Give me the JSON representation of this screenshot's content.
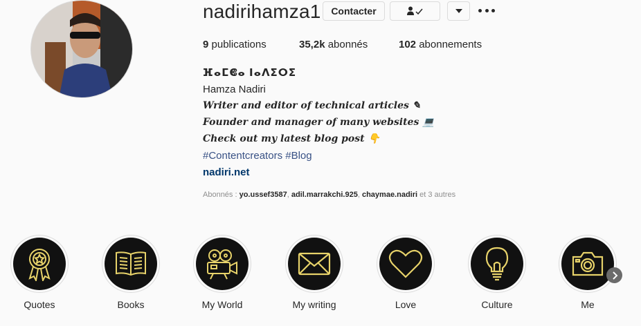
{
  "profile": {
    "username": "nadirihamza1",
    "contact_label": "Contacter",
    "follow_status_icon": "person-check-icon",
    "dropdown_icon": "caret-down-icon",
    "more_icon": "more-options-icon"
  },
  "stats": {
    "posts_count": "9",
    "posts_label": " publications",
    "followers_count": "35,2k",
    "followers_label": " abonnés",
    "following_count": "102",
    "following_label": " abonnements"
  },
  "bio": {
    "tifinagh_name": "ⴼⴰⵎⵞⴰ ⵏⴰⴷⵉⵔⵉ",
    "full_name": "Hamza Nadiri",
    "line1": "Writer and editor of technical articles ✎",
    "line2": "Founder and manager of many websites 💻",
    "line3": "Check out my latest blog post 👇",
    "hashtags": "#Contentcreators #Blog",
    "website": "nadiri.net"
  },
  "followed_by": {
    "prefix": "Abonnés : ",
    "user1": "yo.ussef3587",
    "sep1": ", ",
    "user2": "adil.marrakchi.925",
    "sep2": ", ",
    "user3": "chaymae.nadiri",
    "suffix": " et 3 autres"
  },
  "highlights": [
    {
      "label": "Quotes",
      "icon": "award-ribbon-icon"
    },
    {
      "label": "Books",
      "icon": "open-book-icon"
    },
    {
      "label": "My World",
      "icon": "film-camera-icon"
    },
    {
      "label": "My writing",
      "icon": "envelope-icon"
    },
    {
      "label": "Love",
      "icon": "heart-icon"
    },
    {
      "label": "Culture",
      "icon": "lightbulb-icon"
    },
    {
      "label": "Me",
      "icon": "camera-icon"
    }
  ],
  "colors": {
    "highlight_icon": "#e8d36a",
    "highlight_bg": "#111111",
    "link": "#00376b",
    "hashtag": "#385185",
    "muted": "#8e8e8e"
  }
}
